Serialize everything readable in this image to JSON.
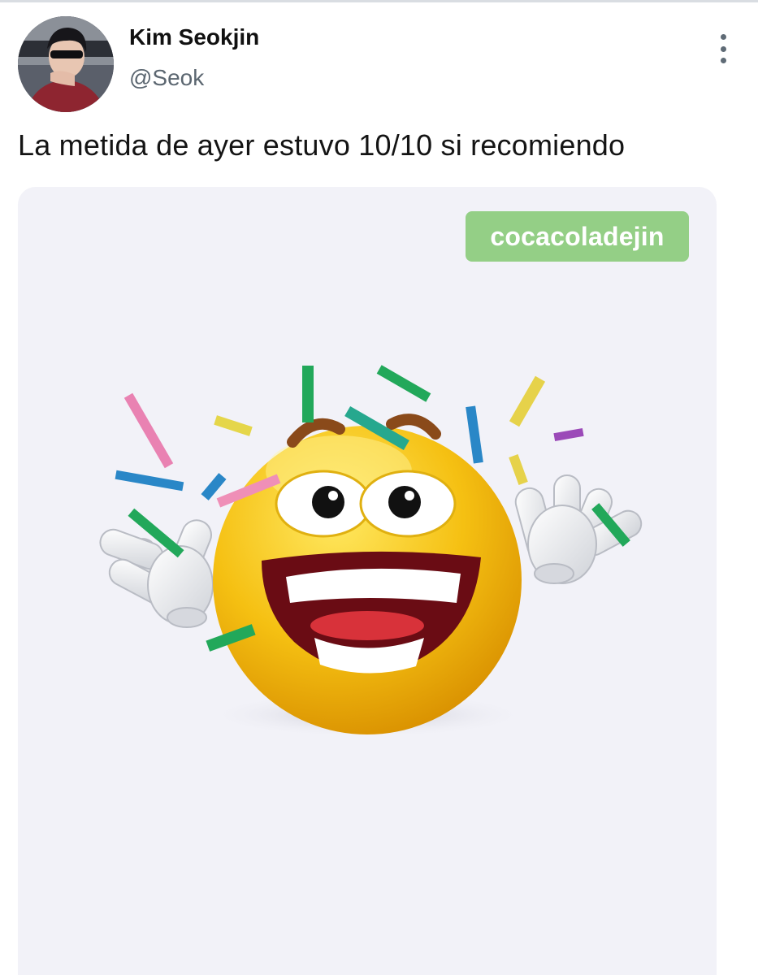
{
  "tweet": {
    "author_name": "Kim Seokjin",
    "author_handle": "@Seok",
    "text": "La metida de ayer estuvo 10/10 si recomiendo",
    "more_icon": "more-vertical-icon"
  },
  "media": {
    "watermark": "cocacoladejin",
    "image_subject": "laughing-emoji-with-confetti"
  },
  "colors": {
    "watermark_bg": "#94cf86",
    "media_bg": "#f2f2f8",
    "emoji_yellow": "#f7c316"
  }
}
